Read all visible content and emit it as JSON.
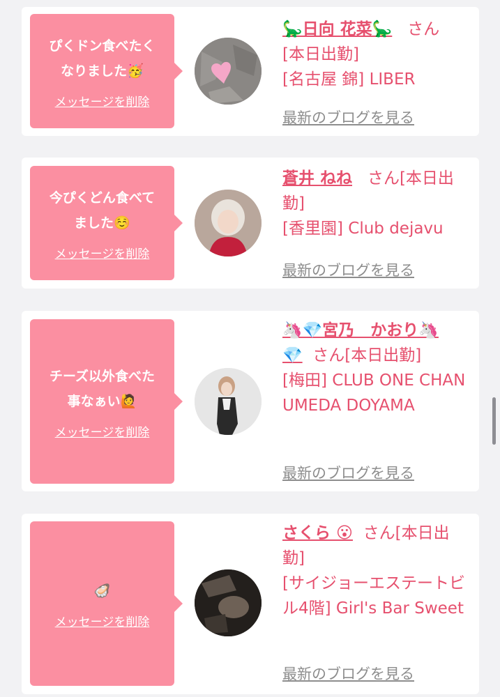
{
  "delete_label": "メッセージを削除",
  "blog_label": "最新のブログを見る",
  "san_suffix": "さん",
  "accent_color": "#fb8fa1",
  "name_color": "#e6506e",
  "cards": [
    {
      "message": "ぴくドン食べたく\nなりました🥳",
      "name": "🦕日向 花菜🦕",
      "status": "[本日出勤]",
      "shop": "[名古屋 錦] LIBER",
      "avatar_icon": "pink-heart-on-stone"
    },
    {
      "message": "今ぴくどん食べて\nました☺️",
      "name": "蒼井 ねね",
      "status": "[本日出勤]",
      "shop": "[香里園] Club dejavu",
      "avatar_icon": "woman-portrait"
    },
    {
      "message": "チーズ以外食べた\n事なぁい🙋",
      "name": "🦄💎宮乃　かおり🦄💎",
      "status": "[本日出勤]",
      "shop": "[梅田] CLUB ONE CHAN UMEDA DOYAMA",
      "avatar_icon": "woman-portrait"
    },
    {
      "message": "🦪",
      "name": "さくら 😮",
      "status": "[本日出勤]",
      "shop": "[サイジョーエステートビル4階] Girl's Bar Sweet",
      "avatar_icon": "dark-photo"
    }
  ]
}
